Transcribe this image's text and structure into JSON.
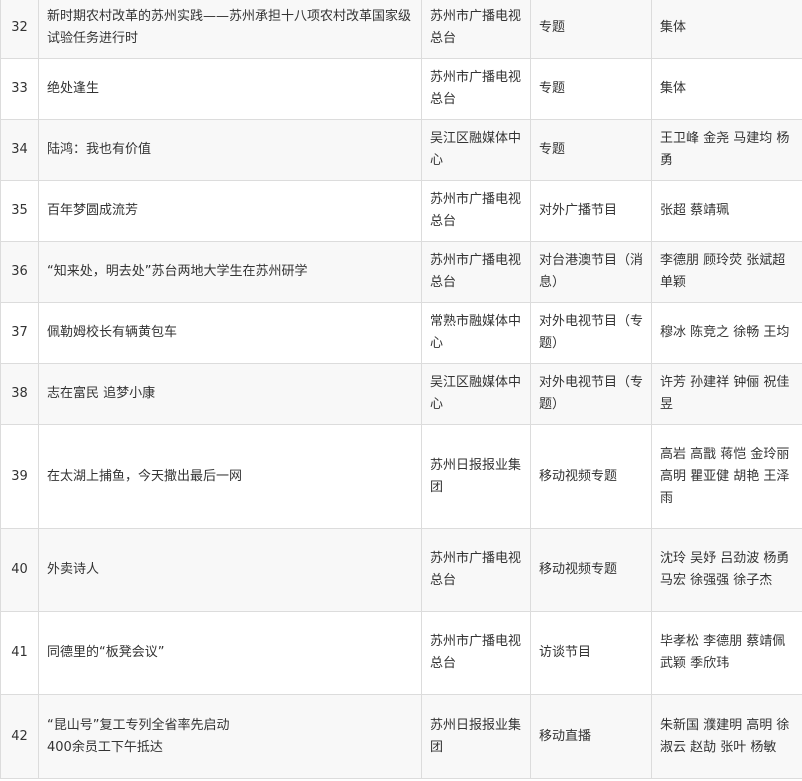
{
  "rows": [
    {
      "no": "32",
      "title": [
        "新时期农村改革的苏州实践——苏州承担十八项农村改革国家级试验任务进行时"
      ],
      "unit": "苏州市广播电视总台",
      "type": "专题",
      "author": [
        "集体"
      ]
    },
    {
      "no": "33",
      "title": [
        "绝处逢生"
      ],
      "unit": "苏州市广播电视总台",
      "type": "专题",
      "author": [
        "集体"
      ]
    },
    {
      "no": "34",
      "title": [
        "陆鸿：我也有价值"
      ],
      "unit": "吴江区融媒体中心",
      "type": "专题",
      "author": [
        "王卫峰 金尧 马建均 杨勇"
      ]
    },
    {
      "no": "35",
      "title": [
        "百年梦圆成流芳"
      ],
      "unit": "苏州市广播电视总台",
      "type": "对外广播节目",
      "author": [
        "张超 蔡靖珮"
      ]
    },
    {
      "no": "36",
      "title": [
        "“知来处，明去处”苏台两地大学生在苏州研学"
      ],
      "unit": "苏州市广播电视总台",
      "type": "对台港澳节目（消息）",
      "author": [
        "李德朋 顾玲荧 张斌超 单颖"
      ]
    },
    {
      "no": "37",
      "title": [
        "佩勒姆校长有辆黄包车"
      ],
      "unit": "常熟市融媒体中心",
      "type": "对外电视节目（专题）",
      "author": [
        "穆冰 陈竞之 徐畅 王均"
      ]
    },
    {
      "no": "38",
      "title": [
        "志在富民 追梦小康"
      ],
      "unit": "吴江区融媒体中心",
      "type": "对外电视节目（专题）",
      "author": [
        "许芳 孙建祥 钟俪 祝佳昱"
      ]
    },
    {
      "no": "39",
      "title": [
        "在太湖上捕鱼，今天撒出最后一网"
      ],
      "unit": "苏州日报报业集团",
      "type": "移动视频专题",
      "author": [
        "高岩 高戬 蒋恺 金玲丽",
        "高明 瞿亚健 胡艳 王泽雨"
      ]
    },
    {
      "no": "40",
      "title": [
        "外卖诗人"
      ],
      "unit": "苏州市广播电视总台",
      "type": "移动视频专题",
      "author": [
        "沈玲 吴妤 吕劲波 杨勇",
        "马宏 徐强强 徐子杰"
      ]
    },
    {
      "no": "41",
      "title": [
        "同德里的“板凳会议”"
      ],
      "unit": "苏州市广播电视总台",
      "type": "访谈节目",
      "author": [
        "毕孝松 李德朋 蔡靖佩",
        "武颖 季欣玮"
      ]
    },
    {
      "no": "42",
      "title": [
        "“昆山号”复工专列全省率先启动",
        "400余员工下午抵达"
      ],
      "unit": "苏州日报报业集团",
      "type": "移动直播",
      "author": [
        "朱新国 濮建明 高明 徐淑云 赵劼 张叶 杨敏"
      ]
    }
  ]
}
